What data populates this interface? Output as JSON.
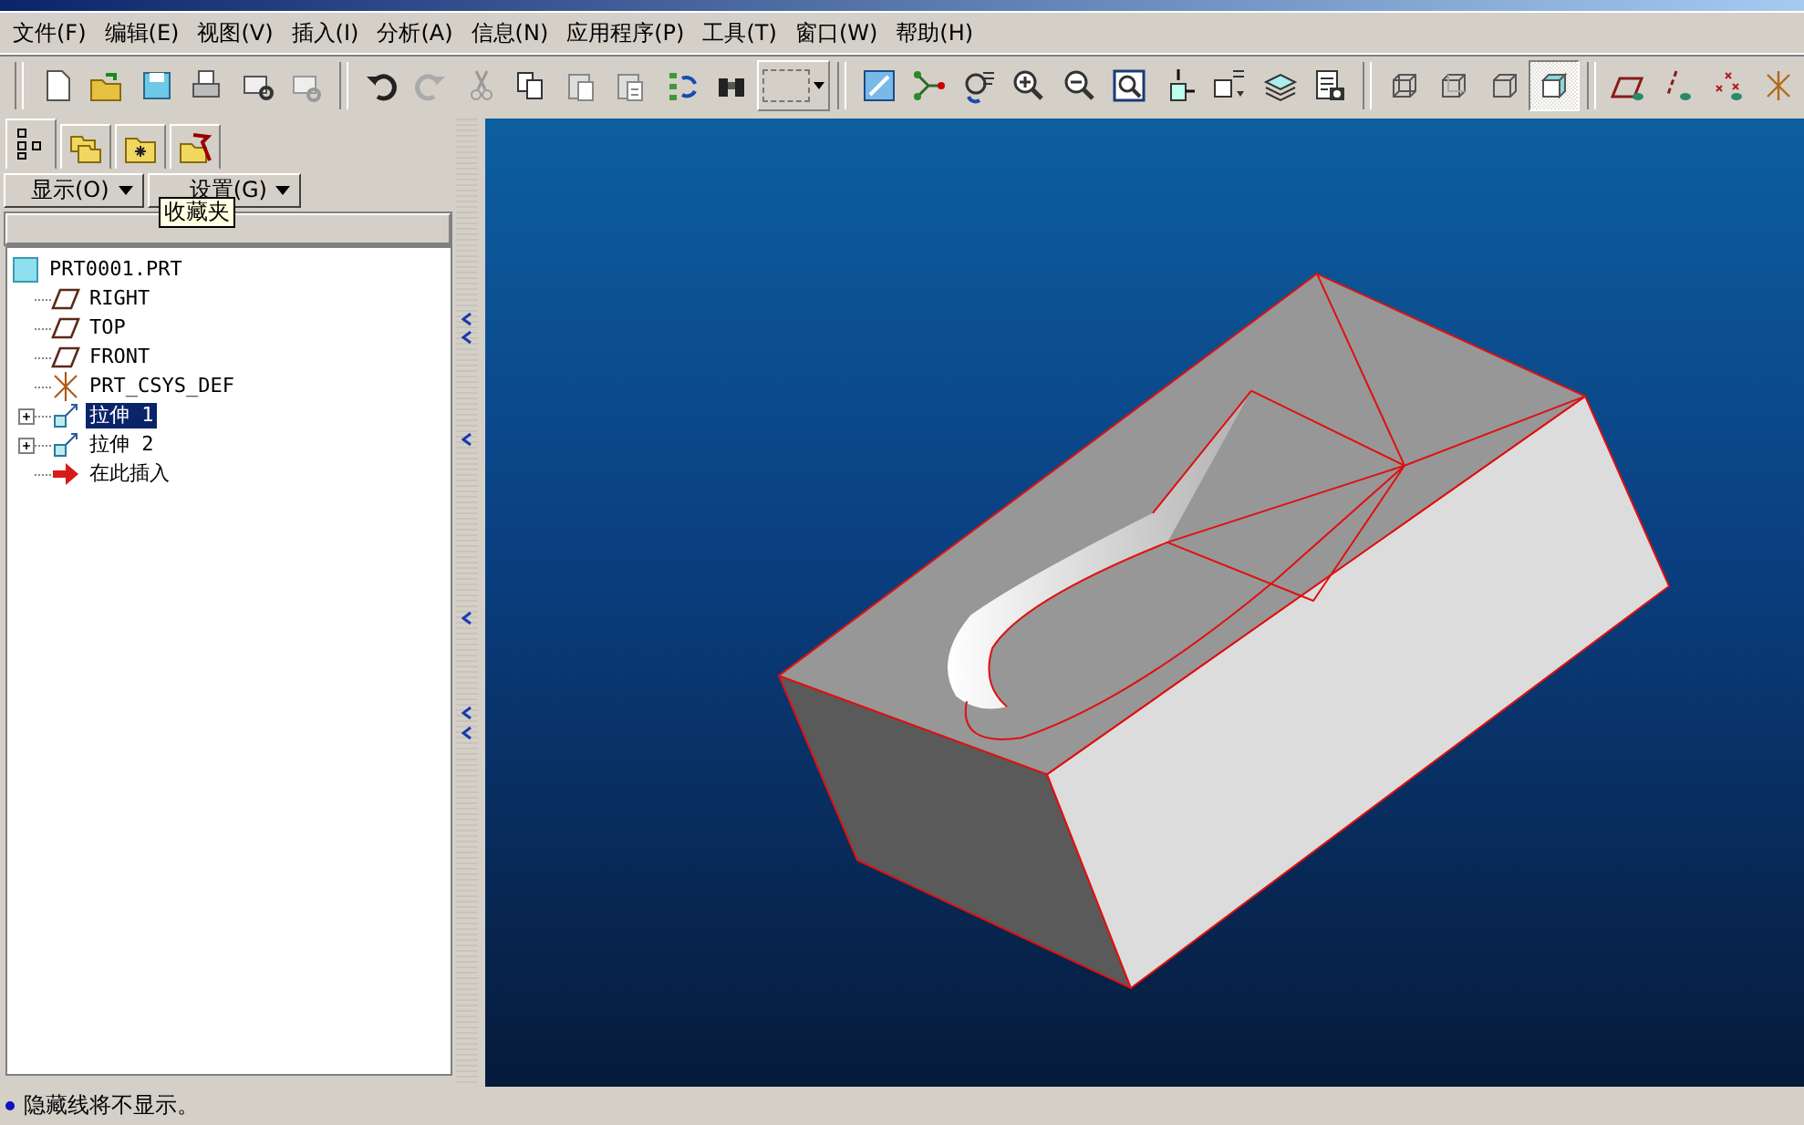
{
  "menu": [
    "文件(F)",
    "编辑(E)",
    "视图(V)",
    "插入(I)",
    "分析(A)",
    "信息(N)",
    "应用程序(P)",
    "工具(T)",
    "窗口(W)",
    "帮助(H)"
  ],
  "toolbar": {
    "display_styles": [
      {
        "selected": false
      },
      {
        "selected": false
      },
      {
        "selected": false
      },
      {
        "selected": true
      }
    ]
  },
  "model_tree": {
    "tabs": [
      {
        "selected": true
      },
      {
        "selected": false
      },
      {
        "selected": false
      },
      {
        "selected": false
      }
    ],
    "buttons": [
      "显示(O)",
      "设置(G)"
    ],
    "tooltip": "收藏夹",
    "root": {
      "label": "PRT0001.PRT",
      "children": [
        {
          "label": "RIGHT",
          "kind": "plane",
          "selected": false
        },
        {
          "label": "TOP",
          "kind": "plane",
          "selected": false
        },
        {
          "label": "FRONT",
          "kind": "plane",
          "selected": false
        },
        {
          "label": "PRT_CSYS_DEF",
          "kind": "csys",
          "selected": false
        },
        {
          "label": "拉伸 1",
          "kind": "extrude",
          "selected": true,
          "expanded": false
        },
        {
          "label": "拉伸 2",
          "kind": "extrude",
          "selected": false,
          "expanded": false
        },
        {
          "label": "在此插入",
          "kind": "insert",
          "selected": false
        }
      ]
    }
  },
  "status_bar": {
    "message": "隐藏线将不显示。"
  }
}
